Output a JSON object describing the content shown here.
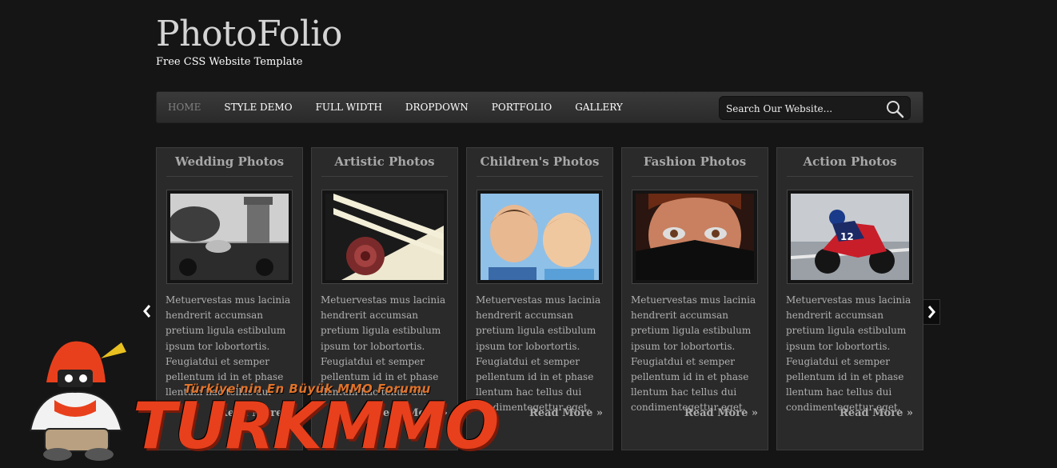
{
  "header": {
    "title": "PhotoFolio",
    "tagline": "Free CSS Website Template"
  },
  "nav": {
    "items": [
      "HOME",
      "STYLE DEMO",
      "FULL WIDTH",
      "DROPDOWN",
      "PORTFOLIO",
      "GALLERY"
    ],
    "active_index": 0
  },
  "search": {
    "placeholder": "Search Our Website...",
    "icon": "search-icon"
  },
  "slider": {
    "prev_icon": "chevron-left-icon",
    "next_icon": "chevron-right-icon"
  },
  "cards": [
    {
      "title": "Wedding Photos",
      "text": "Metuervestas mus lacinia hendrerit accumsan pretium ligula estibulum ipsum tor lobortortis. Feugiatdui et semper pellentum id in et phase llentum hac tellus dui",
      "more": "Read More »"
    },
    {
      "title": "Artistic Photos",
      "text": "Metuervestas mus lacinia hendrerit accumsan pretium ligula estibulum ipsum tor lobortortis. Feugiatdui et semper pellentum id in et phase llentum hac tellus dui",
      "more": "Read More »"
    },
    {
      "title": "Children's Photos",
      "text": "Metuervestas mus lacinia hendrerit accumsan pretium ligula estibulum ipsum tor lobortortis. Feugiatdui et semper pellentum id in et phase llentum hac tellus dui condimentegettur eget.",
      "more": "Read More »"
    },
    {
      "title": "Fashion Photos",
      "text": "Metuervestas mus lacinia hendrerit accumsan pretium ligula estibulum ipsum tor lobortortis. Feugiatdui et semper pellentum id in et phase llentum hac tellus dui condimentegettur eget.",
      "more": "Read More »"
    },
    {
      "title": "Action Photos",
      "text": "Metuervestas mus lacinia hendrerit accumsan pretium ligula estibulum ipsum tor lobortortis. Feugiatdui et semper pellentum id in et phase llentum hac tellus dui condimentegettur eget.",
      "more": "Read More »"
    }
  ],
  "watermark": {
    "slogan": "Türkiye'nin En Büyük MMO Forumu",
    "brand": "TURKMMO"
  },
  "colors": {
    "background": "#151515",
    "nav_active": "#808080",
    "card_bg": "#2a2a2a",
    "card_title": "#a8a8a8",
    "watermark_orange": "#e8401c"
  }
}
